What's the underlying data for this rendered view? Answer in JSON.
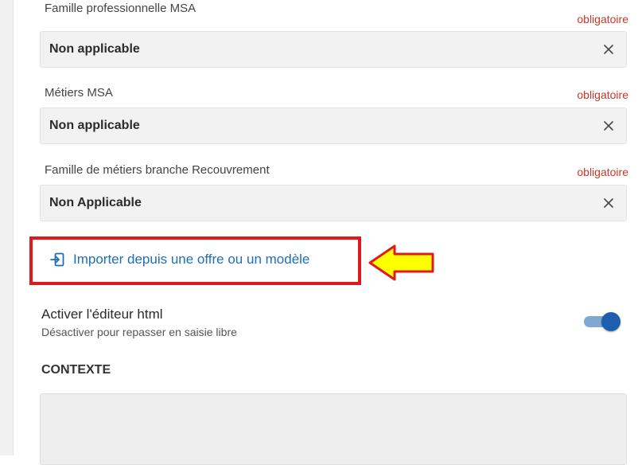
{
  "fields": [
    {
      "label": "Famille professionnelle MSA",
      "required": "obligatoire",
      "value": "Non applicable"
    },
    {
      "label": "Métiers MSA",
      "required": "obligatoire",
      "value": "Non applicable"
    },
    {
      "label": "Famille de métiers branche Recouvrement",
      "required": "obligatoire",
      "value": "Non Applicable"
    }
  ],
  "import_link": {
    "label": "Importer depuis une offre ou un modèle",
    "icon": "import-icon"
  },
  "html_editor": {
    "title": "Activer l'éditeur html",
    "subtitle": "Désactiver pour repasser en saisie libre",
    "enabled": true
  },
  "section": {
    "title": "CONTEXTE",
    "content": ""
  },
  "colors": {
    "accent": "#1f6fb5",
    "required": "#c0392b",
    "highlight_box": "#e0191d",
    "arrow_fill": "#ffff00",
    "arrow_outline": "#e0191d",
    "toggle_track": "#7fa8d4",
    "toggle_knob": "#1d5fae"
  }
}
